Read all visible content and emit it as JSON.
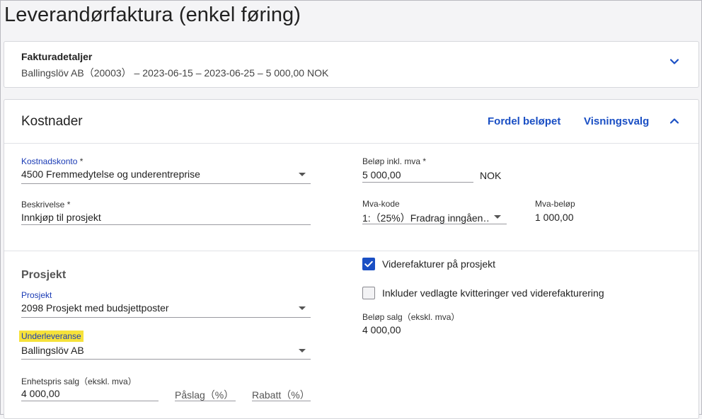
{
  "page": {
    "title": "Leverandørfaktura (enkel føring)"
  },
  "invoice_details": {
    "title": "Fakturadetaljer",
    "summary": "Ballingslöv AB（20003） –  2023-06-15  –  2023-06-25  –  5 000,00 NOK"
  },
  "costs": {
    "title": "Kostnader",
    "distribute_label": "Fordel beløpet",
    "view_options_label": "Visningsvalg",
    "cost_account": {
      "label": "Kostnadskonto",
      "value": "4500 Fremmedytelse og underentreprise"
    },
    "description": {
      "label": "Beskrivelse",
      "value": "Innkjøp til prosjekt"
    },
    "amount_incl_vat": {
      "label": "Beløp inkl. mva",
      "value": "5 000,00",
      "currency": "NOK"
    },
    "vat_code": {
      "label": "Mva-kode",
      "value": "1:（25%）Fradrag inngåen…"
    },
    "vat_amount": {
      "label": "Mva-beløp",
      "value": "1 000,00"
    },
    "required_marker": " *"
  },
  "project": {
    "section_title": "Prosjekt",
    "project_field": {
      "label": "Prosjekt",
      "value": "2098 Prosjekt med budsjettposter"
    },
    "subdelivery": {
      "label": "Underleveranse",
      "value": "Ballingslöv AB"
    },
    "unit_price": {
      "label": "Enhetspris salg（ekskl. mva）",
      "value": "4 000,00"
    },
    "markup": {
      "placeholder": "Påslag（%）"
    },
    "discount": {
      "placeholder": "Rabatt（%）"
    },
    "reinvoice": {
      "label": "Viderefakturer på prosjekt",
      "checked": true
    },
    "include_receipts": {
      "label": "Inkluder vedlagte kvitteringer ved viderefakturering",
      "checked": false
    },
    "sales_amount": {
      "label": "Beløp salg（ekskl. mva）",
      "value": "4 000,00"
    }
  },
  "colors": {
    "accent": "#1a4fc4",
    "highlight": "#f6e23a",
    "label_blue": "#1a3bb5"
  }
}
